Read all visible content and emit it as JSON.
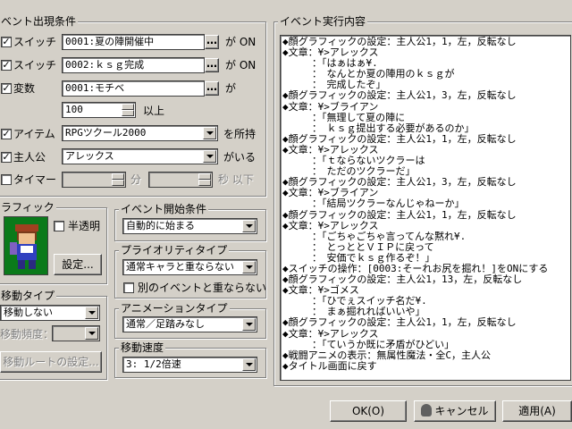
{
  "conditions": {
    "title": "ベント出現条件",
    "switch1": {
      "label": "スイッチ",
      "value": "0001:夏の陣開催中",
      "suffix": "が ON"
    },
    "switch2": {
      "label": "スイッチ",
      "value": "0002:ｋｓｇ完成",
      "suffix": "が ON"
    },
    "variable": {
      "label": "変数",
      "value": "0001:モチベ",
      "suffix": "が",
      "number": "100",
      "number_suffix": "以上"
    },
    "item": {
      "label": "アイテム",
      "value": "RPGツクール2000",
      "suffix": "を所持"
    },
    "actor": {
      "label": "主人公",
      "value": "アレックス",
      "suffix": "がいる"
    },
    "timer": {
      "label": "タイマー",
      "min_suffix": "分",
      "sec_suffix": "秒 以下"
    }
  },
  "graphic": {
    "title": "ラフィック",
    "transparent_label": "半透明",
    "settings_button": "設定..."
  },
  "trigger": {
    "title": "イベント開始条件",
    "value": "自動的に始まる"
  },
  "priority": {
    "title": "プライオリティタイプ",
    "value": "通常キャラと重ならない",
    "overlap_label": "別のイベントと重ならない"
  },
  "animation": {
    "title": "アニメーションタイプ",
    "value": "通常／足踏みなし"
  },
  "speed": {
    "title": "移動速度",
    "value": "3: 1/2倍速"
  },
  "movement": {
    "title": "移動タイプ",
    "type_value": "移動しない",
    "frequency_label": "移動頻度：",
    "route_button": "移動ルートの設定..."
  },
  "event_content": {
    "title": "イベント実行内容",
    "lines": [
      "◆顔グラフィックの設定：主人公1，1，左，反転なし",
      "◆文章：¥>アレックス",
      "　　　：「はぁはぁ¥.",
      "　　　：　なんとか夏の陣用のｋｓｇが",
      "　　　：　完成したぞ」",
      "◆顔グラフィックの設定：主人公1，3，左，反転なし",
      "◆文章：¥>ブライアン",
      "　　　：「無理して夏の陣に",
      "　　　：　ｋｓｇ提出する必要があるのか」",
      "◆顔グラフィックの設定：主人公1，1，左，反転なし",
      "◆文章：¥>アレックス",
      "　　　：「ｔならないツクラーは",
      "　　　：　ただのツクラーだ」",
      "◆顔グラフィックの設定：主人公1，3，左，反転なし",
      "◆文章：¥>ブライアン",
      "　　　：「結局ツクラーなんじゃねーか」",
      "◆顔グラフィックの設定：主人公1，1，左，反転なし",
      "◆文章：¥>アレックス",
      "　　　：「ごちゃごちゃ言ってんな黙れ¥.",
      "　　　：　とっととＶＩＰに戻って",
      "　　　：　安価でｋｓｇ作るぞ！」",
      "◆スイッチの操作：[0003:そーれお尻を掘れ！]をONにする",
      "◆顔グラフィックの設定：主人公1，13，左，反転なし",
      "◆文章：¥>ゴメス",
      "　　　：「ひでぇスイッチ名だ¥.",
      "　　　：　まぁ掘れればいいや」",
      "◆顔グラフィックの設定：主人公1，1，左，反転なし",
      "◆文章：¥>アレックス",
      "　　　：「ていうか既に矛盾がひどい」",
      "◆戦闘アニメの表示：無属性魔法・全C，主人公",
      "◆タイトル画面に戻す"
    ]
  },
  "footer": {
    "ok": "OK(O)",
    "cancel": "キャンセル",
    "apply": "適用(A)"
  },
  "icons": {
    "checkbox": "checkmark-icon",
    "spin": "spinner-icon",
    "dropdown": "dropdown-arrow-icon",
    "cancel": "face-icon"
  }
}
